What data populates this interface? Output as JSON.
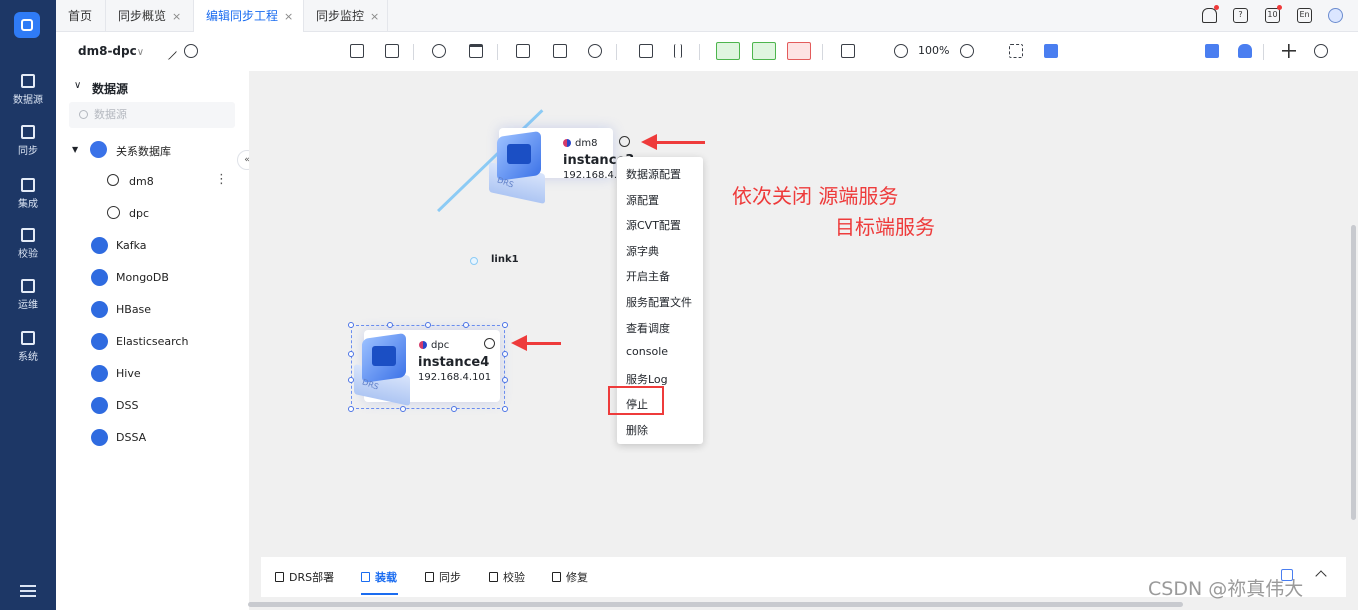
{
  "nav": {
    "logo_icon": "app-logo-icon",
    "items": [
      {
        "label": "数据源",
        "icon": "database-icon"
      },
      {
        "label": "同步",
        "icon": "sync-icon"
      },
      {
        "label": "集成",
        "icon": "integration-icon"
      },
      {
        "label": "校验",
        "icon": "check-icon"
      },
      {
        "label": "运维",
        "icon": "ops-icon"
      },
      {
        "label": "系统",
        "icon": "system-icon"
      }
    ]
  },
  "tabs": [
    {
      "label": "首页",
      "closable": false
    },
    {
      "label": "同步概览",
      "closable": true
    },
    {
      "label": "编辑同步工程",
      "closable": true,
      "active": true
    },
    {
      "label": "同步监控",
      "closable": true
    }
  ],
  "tab_close": "×",
  "header_icons": [
    "bell-icon",
    "help-icon",
    "calendar-icon",
    "language-icon",
    "user-avatar"
  ],
  "header_icon_text": {
    "calendar": "10",
    "language": "En"
  },
  "toolbar": {
    "project_name": "dm8-dpc",
    "project_caret": "∨",
    "zoom": "100%"
  },
  "sidebar": {
    "title": "数据源",
    "search_placeholder": "数据源",
    "collapse_glyph": "«",
    "group": "关系数据库",
    "group_children": [
      "dm8",
      "dpc"
    ],
    "items": [
      "Kafka",
      "MongoDB",
      "HBase",
      "Elasticsearch",
      "Hive",
      "DSS",
      "DSSA"
    ]
  },
  "canvas": {
    "node1": {
      "type": "dm8",
      "name": "instance3",
      "ip": "192.168.4.104",
      "badge": "DRS"
    },
    "node2": {
      "type": "dpc",
      "name": "instance4",
      "ip": "192.168.4.101",
      "badge": "DRS"
    },
    "link_label": "link1",
    "context_menu": [
      "数据源配置",
      "源配置",
      "源CVT配置",
      "源字典",
      "开启主备",
      "服务配置文件",
      "查看调度",
      "console",
      "服务Log",
      "停止",
      "删除"
    ],
    "annotation_line1": "依次关闭 源端服务",
    "annotation_line2": "目标端服务",
    "annotation_color": "#ee3b3b"
  },
  "bottom_tabs": [
    {
      "label": "DRS部署"
    },
    {
      "label": "装载",
      "active": true
    },
    {
      "label": "同步"
    },
    {
      "label": "校验"
    },
    {
      "label": "修复"
    }
  ],
  "watermark": "CSDN @祢真伟大",
  "colors": {
    "nav_bg": "#1d3766",
    "accent": "#1a6cf0",
    "link": "#8ccbf5"
  }
}
